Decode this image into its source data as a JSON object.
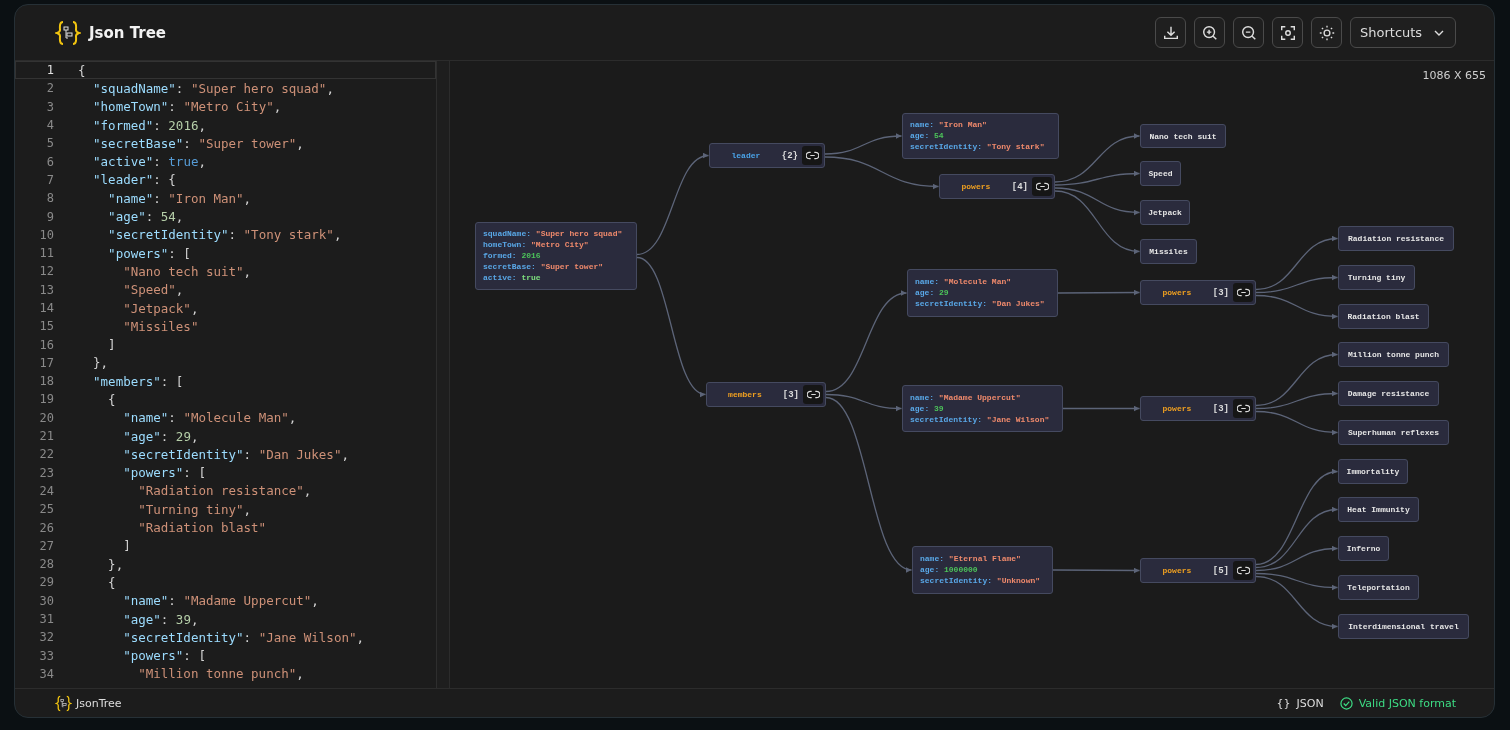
{
  "header": {
    "title": "Json Tree",
    "shortcuts": "Shortcuts"
  },
  "editor": {
    "lines": [
      {
        "number": "1",
        "current": true,
        "tokens": [
          {
            "kind": "punct",
            "text": "{"
          }
        ]
      },
      {
        "number": "2",
        "current": false,
        "tokens": [
          {
            "kind": "key",
            "text": "  \"squadName\""
          },
          {
            "kind": "punct",
            "text": ": "
          },
          {
            "kind": "string",
            "text": "\"Super hero squad\""
          },
          {
            "kind": "punct",
            "text": ","
          }
        ]
      },
      {
        "number": "3",
        "current": false,
        "tokens": [
          {
            "kind": "key",
            "text": "  \"homeTown\""
          },
          {
            "kind": "punct",
            "text": ": "
          },
          {
            "kind": "string",
            "text": "\"Metro City\""
          },
          {
            "kind": "punct",
            "text": ","
          }
        ]
      },
      {
        "number": "4",
        "current": false,
        "tokens": [
          {
            "kind": "key",
            "text": "  \"formed\""
          },
          {
            "kind": "punct",
            "text": ": "
          },
          {
            "kind": "number",
            "text": "2016"
          },
          {
            "kind": "punct",
            "text": ","
          }
        ]
      },
      {
        "number": "5",
        "current": false,
        "tokens": [
          {
            "kind": "key",
            "text": "  \"secretBase\""
          },
          {
            "kind": "punct",
            "text": ": "
          },
          {
            "kind": "string",
            "text": "\"Super tower\""
          },
          {
            "kind": "punct",
            "text": ","
          }
        ]
      },
      {
        "number": "6",
        "current": false,
        "tokens": [
          {
            "kind": "key",
            "text": "  \"active\""
          },
          {
            "kind": "punct",
            "text": ": "
          },
          {
            "kind": "boolean",
            "text": "true"
          },
          {
            "kind": "punct",
            "text": ","
          }
        ]
      },
      {
        "number": "7",
        "current": false,
        "tokens": [
          {
            "kind": "key",
            "text": "  \"leader\""
          },
          {
            "kind": "punct",
            "text": ": {"
          }
        ]
      },
      {
        "number": "8",
        "current": false,
        "tokens": [
          {
            "kind": "key",
            "text": "    \"name\""
          },
          {
            "kind": "punct",
            "text": ": "
          },
          {
            "kind": "string",
            "text": "\"Iron Man\""
          },
          {
            "kind": "punct",
            "text": ","
          }
        ]
      },
      {
        "number": "9",
        "current": false,
        "tokens": [
          {
            "kind": "key",
            "text": "    \"age\""
          },
          {
            "kind": "punct",
            "text": ": "
          },
          {
            "kind": "number",
            "text": "54"
          },
          {
            "kind": "punct",
            "text": ","
          }
        ]
      },
      {
        "number": "10",
        "current": false,
        "tokens": [
          {
            "kind": "key",
            "text": "    \"secretIdentity\""
          },
          {
            "kind": "punct",
            "text": ": "
          },
          {
            "kind": "string",
            "text": "\"Tony stark\""
          },
          {
            "kind": "punct",
            "text": ","
          }
        ]
      },
      {
        "number": "11",
        "current": false,
        "tokens": [
          {
            "kind": "key",
            "text": "    \"powers\""
          },
          {
            "kind": "punct",
            "text": ": ["
          }
        ]
      },
      {
        "number": "12",
        "current": false,
        "tokens": [
          {
            "kind": "string",
            "text": "      \"Nano tech suit\""
          },
          {
            "kind": "punct",
            "text": ","
          }
        ]
      },
      {
        "number": "13",
        "current": false,
        "tokens": [
          {
            "kind": "string",
            "text": "      \"Speed\""
          },
          {
            "kind": "punct",
            "text": ","
          }
        ]
      },
      {
        "number": "14",
        "current": false,
        "tokens": [
          {
            "kind": "string",
            "text": "      \"Jetpack\""
          },
          {
            "kind": "punct",
            "text": ","
          }
        ]
      },
      {
        "number": "15",
        "current": false,
        "tokens": [
          {
            "kind": "string",
            "text": "      \"Missiles\""
          }
        ]
      },
      {
        "number": "16",
        "current": false,
        "tokens": [
          {
            "kind": "punct",
            "text": "    ]"
          }
        ]
      },
      {
        "number": "17",
        "current": false,
        "tokens": [
          {
            "kind": "punct",
            "text": "  },"
          }
        ]
      },
      {
        "number": "18",
        "current": false,
        "tokens": [
          {
            "kind": "key",
            "text": "  \"members\""
          },
          {
            "kind": "punct",
            "text": ": ["
          }
        ]
      },
      {
        "number": "19",
        "current": false,
        "tokens": [
          {
            "kind": "punct",
            "text": "    {"
          }
        ]
      },
      {
        "number": "20",
        "current": false,
        "tokens": [
          {
            "kind": "key",
            "text": "      \"name\""
          },
          {
            "kind": "punct",
            "text": ": "
          },
          {
            "kind": "string",
            "text": "\"Molecule Man\""
          },
          {
            "kind": "punct",
            "text": ","
          }
        ]
      },
      {
        "number": "21",
        "current": false,
        "tokens": [
          {
            "kind": "key",
            "text": "      \"age\""
          },
          {
            "kind": "punct",
            "text": ": "
          },
          {
            "kind": "number",
            "text": "29"
          },
          {
            "kind": "punct",
            "text": ","
          }
        ]
      },
      {
        "number": "22",
        "current": false,
        "tokens": [
          {
            "kind": "key",
            "text": "      \"secretIdentity\""
          },
          {
            "kind": "punct",
            "text": ": "
          },
          {
            "kind": "string",
            "text": "\"Dan Jukes\""
          },
          {
            "kind": "punct",
            "text": ","
          }
        ]
      },
      {
        "number": "23",
        "current": false,
        "tokens": [
          {
            "kind": "key",
            "text": "      \"powers\""
          },
          {
            "kind": "punct",
            "text": ": ["
          }
        ]
      },
      {
        "number": "24",
        "current": false,
        "tokens": [
          {
            "kind": "string",
            "text": "        \"Radiation resistance\""
          },
          {
            "kind": "punct",
            "text": ","
          }
        ]
      },
      {
        "number": "25",
        "current": false,
        "tokens": [
          {
            "kind": "string",
            "text": "        \"Turning tiny\""
          },
          {
            "kind": "punct",
            "text": ","
          }
        ]
      },
      {
        "number": "26",
        "current": false,
        "tokens": [
          {
            "kind": "string",
            "text": "        \"Radiation blast\""
          }
        ]
      },
      {
        "number": "27",
        "current": false,
        "tokens": [
          {
            "kind": "punct",
            "text": "      ]"
          }
        ]
      },
      {
        "number": "28",
        "current": false,
        "tokens": [
          {
            "kind": "punct",
            "text": "    },"
          }
        ]
      },
      {
        "number": "29",
        "current": false,
        "tokens": [
          {
            "kind": "punct",
            "text": "    {"
          }
        ]
      },
      {
        "number": "30",
        "current": false,
        "tokens": [
          {
            "kind": "key",
            "text": "      \"name\""
          },
          {
            "kind": "punct",
            "text": ": "
          },
          {
            "kind": "string",
            "text": "\"Madame Uppercut\""
          },
          {
            "kind": "punct",
            "text": ","
          }
        ]
      },
      {
        "number": "31",
        "current": false,
        "tokens": [
          {
            "kind": "key",
            "text": "      \"age\""
          },
          {
            "kind": "punct",
            "text": ": "
          },
          {
            "kind": "number",
            "text": "39"
          },
          {
            "kind": "punct",
            "text": ","
          }
        ]
      },
      {
        "number": "32",
        "current": false,
        "tokens": [
          {
            "kind": "key",
            "text": "      \"secretIdentity\""
          },
          {
            "kind": "punct",
            "text": ": "
          },
          {
            "kind": "string",
            "text": "\"Jane Wilson\""
          },
          {
            "kind": "punct",
            "text": ","
          }
        ]
      },
      {
        "number": "33",
        "current": false,
        "tokens": [
          {
            "kind": "key",
            "text": "      \"powers\""
          },
          {
            "kind": "punct",
            "text": ": ["
          }
        ]
      },
      {
        "number": "34",
        "current": false,
        "tokens": [
          {
            "kind": "string",
            "text": "        \"Million tonne punch\""
          },
          {
            "kind": "punct",
            "text": ","
          }
        ]
      }
    ]
  },
  "canvas": {
    "size": "1086 X 655",
    "root": {
      "kind": "object",
      "rows": [
        {
          "key": "squadName:",
          "value": "\"Super hero squad\"",
          "kind": "string"
        },
        {
          "key": "homeTown:",
          "value": "\"Metro City\"",
          "kind": "string"
        },
        {
          "key": "formed:",
          "value": "2016",
          "kind": "number"
        },
        {
          "key": "secretBase:",
          "value": "\"Super tower\"",
          "kind": "string"
        },
        {
          "key": "active:",
          "value": "true",
          "kind": "boolean"
        }
      ],
      "children": [
        {
          "kind": "object_key",
          "label": "leader",
          "count": "{2}",
          "children": [
            {
              "kind": "object",
              "rows": [
                {
                  "key": "name:",
                  "value": "\"Iron Man\"",
                  "kind": "string"
                },
                {
                  "key": "age:",
                  "value": "54",
                  "kind": "number"
                },
                {
                  "key": "secretIdentity:",
                  "value": "\"Tony stark\"",
                  "kind": "string"
                }
              ]
            },
            {
              "kind": "array_key",
              "label": "powers",
              "count": "[4]",
              "children": [
                {
                  "kind": "value",
                  "text": "Nano tech suit"
                },
                {
                  "kind": "value",
                  "text": "Speed"
                },
                {
                  "kind": "value",
                  "text": "Jetpack"
                },
                {
                  "kind": "value",
                  "text": "Missiles"
                }
              ]
            }
          ]
        },
        {
          "kind": "array_key",
          "label": "members",
          "count": "[3]",
          "children": [
            {
              "kind": "object",
              "rows": [
                {
                  "key": "name:",
                  "value": "\"Molecule Man\"",
                  "kind": "string"
                },
                {
                  "key": "age:",
                  "value": "29",
                  "kind": "number"
                },
                {
                  "key": "secretIdentity:",
                  "value": "\"Dan Jukes\"",
                  "kind": "string"
                }
              ],
              "children": [
                {
                  "kind": "array_key",
                  "label": "powers",
                  "count": "[3]",
                  "children": [
                    {
                      "kind": "value",
                      "text": "Radiation resistance"
                    },
                    {
                      "kind": "value",
                      "text": "Turning tiny"
                    },
                    {
                      "kind": "value",
                      "text": "Radiation blast"
                    }
                  ]
                }
              ]
            },
            {
              "kind": "object",
              "rows": [
                {
                  "key": "name:",
                  "value": "\"Madame Uppercut\"",
                  "kind": "string"
                },
                {
                  "key": "age:",
                  "value": "39",
                  "kind": "number"
                },
                {
                  "key": "secretIdentity:",
                  "value": "\"Jane Wilson\"",
                  "kind": "string"
                }
              ],
              "children": [
                {
                  "kind": "array_key",
                  "label": "powers",
                  "count": "[3]",
                  "children": [
                    {
                      "kind": "value",
                      "text": "Million tonne punch"
                    },
                    {
                      "kind": "value",
                      "text": "Damage resistance"
                    },
                    {
                      "kind": "value",
                      "text": "Superhuman reflexes"
                    }
                  ]
                }
              ]
            },
            {
              "kind": "object",
              "rows": [
                {
                  "key": "name:",
                  "value": "\"Eternal Flame\"",
                  "kind": "string"
                },
                {
                  "key": "age:",
                  "value": "1000000",
                  "kind": "number"
                },
                {
                  "key": "secretIdentity:",
                  "value": "\"Unknown\"",
                  "kind": "string"
                }
              ],
              "children": [
                {
                  "kind": "array_key",
                  "label": "powers",
                  "count": "[5]",
                  "children": [
                    {
                      "kind": "value",
                      "text": "Immortality"
                    },
                    {
                      "kind": "value",
                      "text": "Heat Immunity"
                    },
                    {
                      "kind": "value",
                      "text": "Inferno"
                    },
                    {
                      "kind": "value",
                      "text": "Teleportation"
                    },
                    {
                      "kind": "value",
                      "text": "Interdimensional travel"
                    }
                  ]
                }
              ]
            }
          ]
        }
      ]
    }
  },
  "status_bar": {
    "app_name": "JsonTree",
    "format_icon": "{}",
    "format": "JSON",
    "validity": "Valid JSON format"
  }
}
